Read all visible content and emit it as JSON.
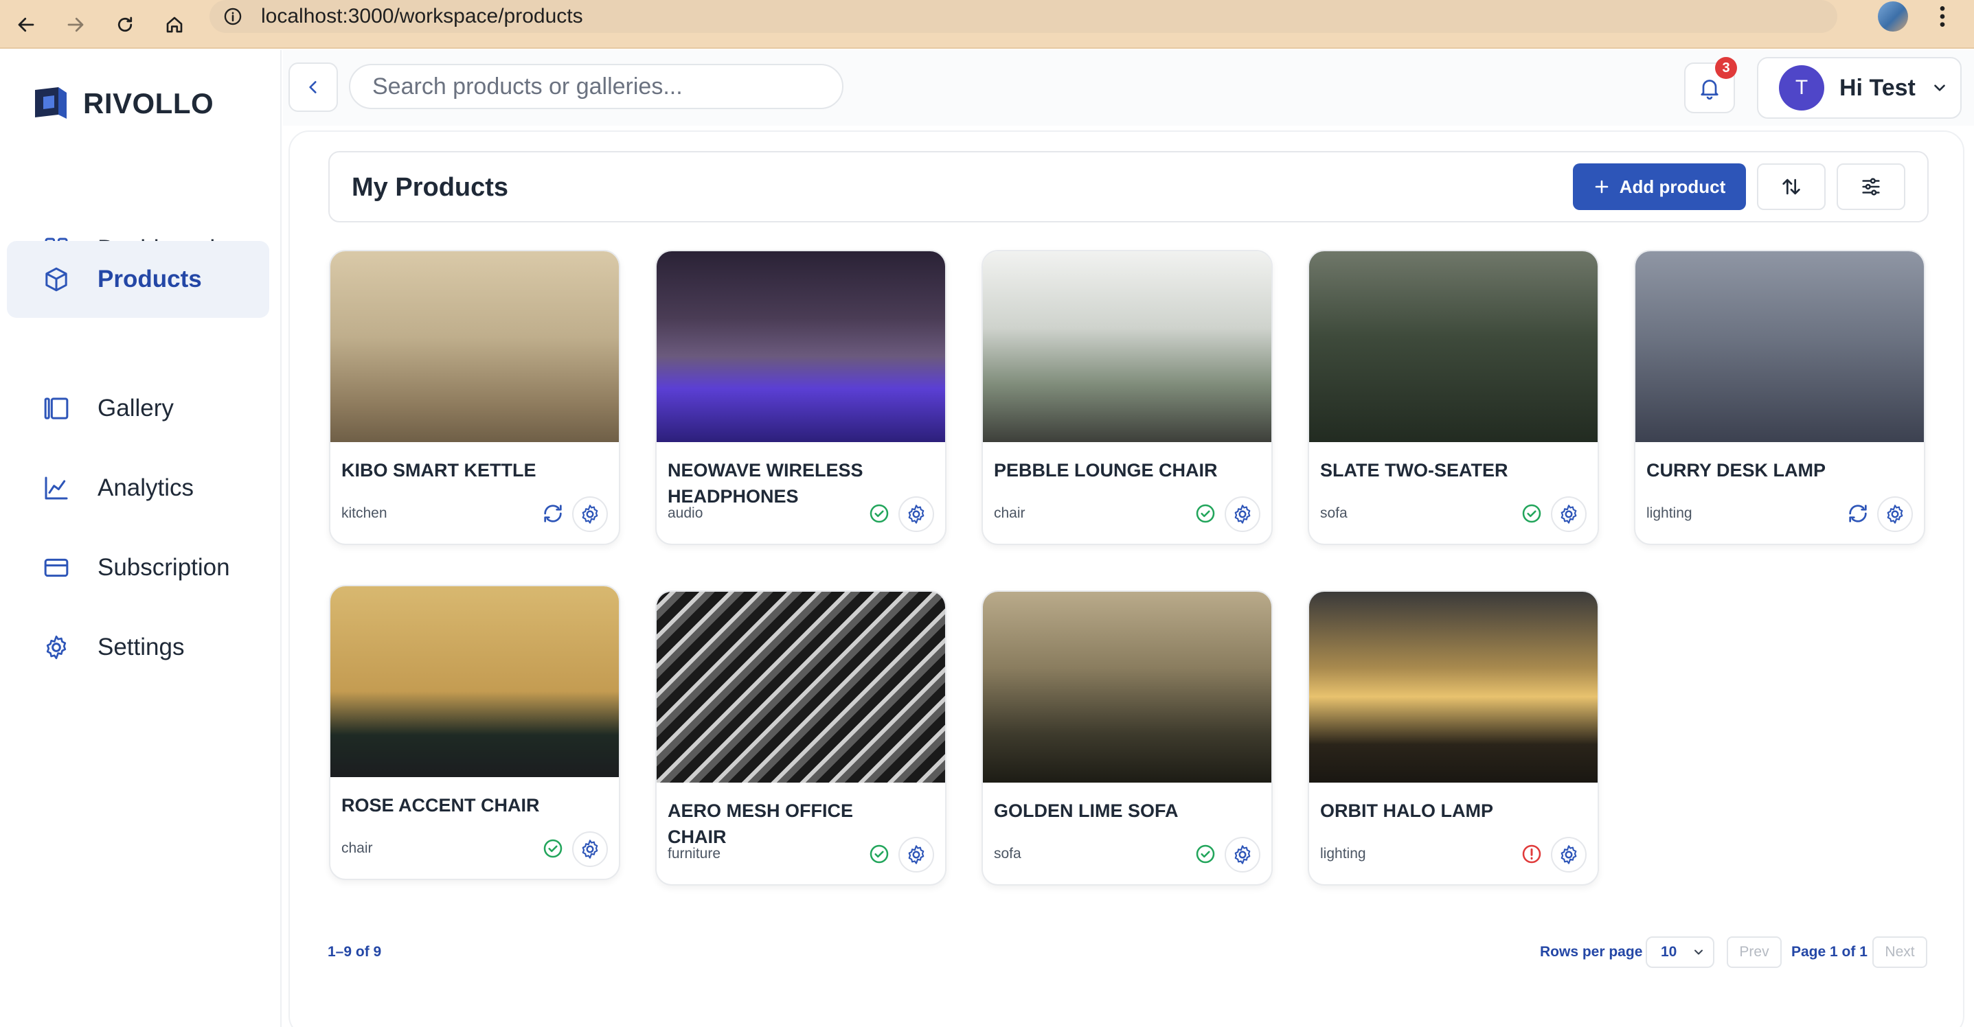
{
  "browser": {
    "url": "localhost:3000/workspace/products",
    "icons": [
      "back-arrow-icon",
      "forward-arrow-icon",
      "reload-icon",
      "home-icon",
      "info-icon",
      "bookmark-star-icon",
      "profile-icon",
      "menu-kebab-icon"
    ]
  },
  "brand": {
    "name": "RIVOLLO",
    "accent": "#2d55b8"
  },
  "sidebar": {
    "items": [
      {
        "label": "Dashboard",
        "icon": "dashboard-grid-icon",
        "active": false
      },
      {
        "label": "Products",
        "icon": "cube-icon",
        "active": true
      },
      {
        "label": "Gallery",
        "icon": "gallery-icon",
        "active": false
      },
      {
        "label": "Analytics",
        "icon": "chart-line-icon",
        "active": false
      },
      {
        "label": "Subscription",
        "icon": "credit-card-icon",
        "active": false
      },
      {
        "label": "Settings",
        "icon": "gear-icon",
        "active": false
      }
    ]
  },
  "header": {
    "search_placeholder": "Search products or galleries...",
    "notification_count": "3",
    "user_initial": "T",
    "user_greeting": "Hi Test"
  },
  "toolbar": {
    "title": "My Products",
    "add_label": "Add product"
  },
  "products": [
    {
      "name": "KIBO SMART KETTLE",
      "category": "kitchen",
      "status": "syncing"
    },
    {
      "name": "NEOWAVE WIRELESS HEADPHONES",
      "category": "audio",
      "status": "ok"
    },
    {
      "name": "PEBBLE LOUNGE CHAIR",
      "category": "chair",
      "status": "ok"
    },
    {
      "name": "SLATE TWO-SEATER",
      "category": "sofa",
      "status": "ok"
    },
    {
      "name": "CURRY DESK LAMP",
      "category": "lighting",
      "status": "syncing"
    },
    {
      "name": "ROSE ACCENT CHAIR",
      "category": "chair",
      "status": "ok"
    },
    {
      "name": "AERO MESH OFFICE CHAIR",
      "category": "furniture",
      "status": "ok"
    },
    {
      "name": "GOLDEN LIME SOFA",
      "category": "sofa",
      "status": "ok"
    },
    {
      "name": "ORBIT HALO LAMP",
      "category": "lighting",
      "status": "error"
    }
  ],
  "status_colors": {
    "ok": "#22a55b",
    "syncing": "#2d55b8",
    "error": "#e03a3a"
  },
  "pagination": {
    "count_text": "1–9 of 9",
    "rows_label": "Rows per page",
    "rows_value": "10",
    "prev_label": "Prev",
    "page_text": "Page 1 of 1",
    "next_label": "Next"
  }
}
